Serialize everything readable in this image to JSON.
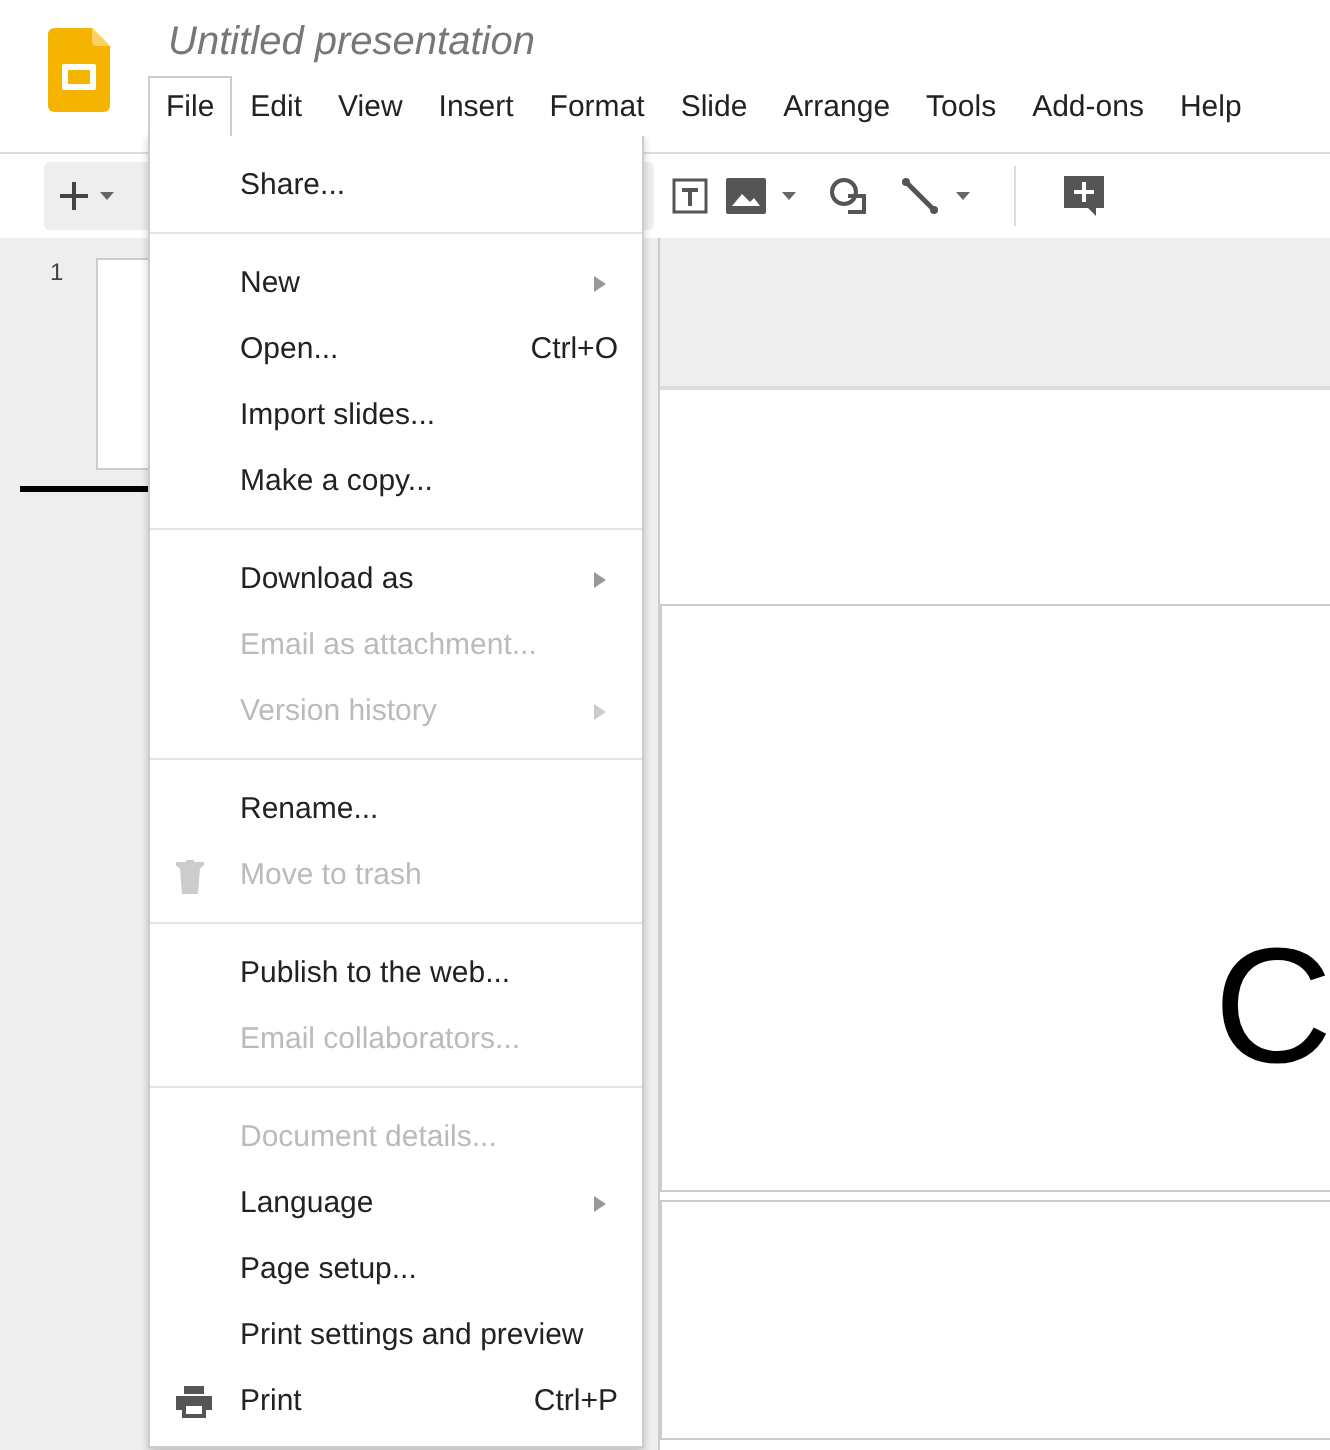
{
  "document": {
    "title": "Untitled presentation"
  },
  "menubar": [
    {
      "label": "File",
      "selected": true
    },
    {
      "label": "Edit",
      "selected": false
    },
    {
      "label": "View",
      "selected": false
    },
    {
      "label": "Insert",
      "selected": false
    },
    {
      "label": "Format",
      "selected": false
    },
    {
      "label": "Slide",
      "selected": false
    },
    {
      "label": "Arrange",
      "selected": false
    },
    {
      "label": "Tools",
      "selected": false
    },
    {
      "label": "Add-ons",
      "selected": false
    },
    {
      "label": "Help",
      "selected": false
    }
  ],
  "filmstrip": {
    "slide_number": "1"
  },
  "slide": {
    "text": "C"
  },
  "file_menu": {
    "sections": [
      [
        {
          "label": "Share...",
          "disabled": false
        }
      ],
      [
        {
          "label": "New",
          "disabled": false,
          "submenu": true
        },
        {
          "label": "Open...",
          "disabled": false,
          "shortcut": "Ctrl+O"
        },
        {
          "label": "Import slides...",
          "disabled": false
        },
        {
          "label": "Make a copy...",
          "disabled": false
        }
      ],
      [
        {
          "label": "Download as",
          "disabled": false,
          "submenu": true
        },
        {
          "label": "Email as attachment...",
          "disabled": true
        },
        {
          "label": "Version history",
          "disabled": true,
          "submenu": true
        }
      ],
      [
        {
          "label": "Rename...",
          "disabled": false
        },
        {
          "label": "Move to trash",
          "disabled": true,
          "kind": "trash"
        }
      ],
      [
        {
          "label": "Publish to the web...",
          "disabled": false
        },
        {
          "label": "Email collaborators...",
          "disabled": true
        }
      ],
      [
        {
          "label": "Document details...",
          "disabled": true
        },
        {
          "label": "Language",
          "disabled": false,
          "submenu": true
        },
        {
          "label": "Page setup...",
          "disabled": false
        },
        {
          "label": "Print settings and preview",
          "disabled": false
        },
        {
          "label": "Print",
          "disabled": false,
          "shortcut": "Ctrl+P",
          "kind": "printer"
        }
      ]
    ]
  }
}
